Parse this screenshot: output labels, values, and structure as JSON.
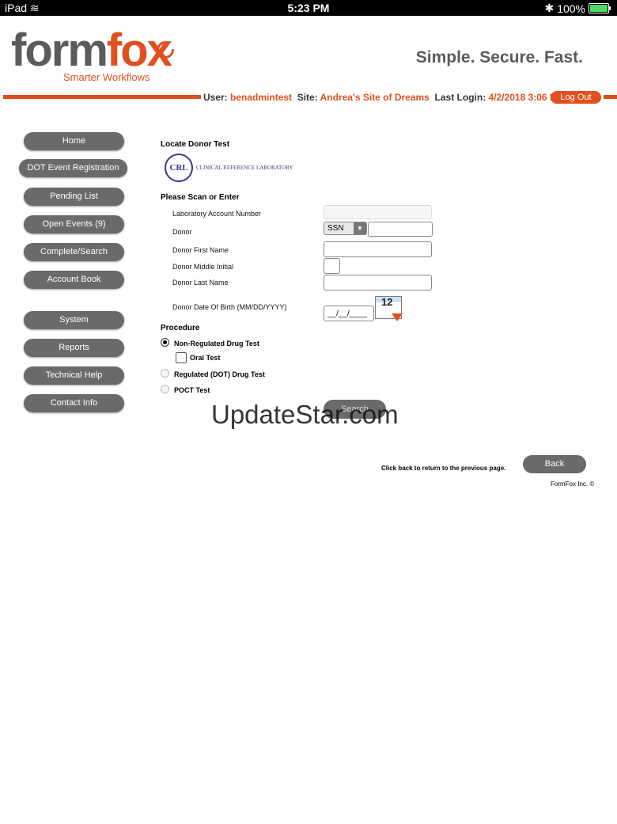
{
  "status_bar": {
    "device": "iPad",
    "time": "5:23 PM",
    "battery": "100%"
  },
  "brand": {
    "logo_form": "form",
    "logo_fox": "fox",
    "tagline": "Smarter Workflows",
    "slogan": "Simple. Secure. Fast.",
    "accent_color": "#e0501f"
  },
  "session": {
    "user_label": "User:",
    "user_value": "benadmintest",
    "site_label": "Site:",
    "site_value": "Andrea's Site of Dreams",
    "last_login_label": "Last Login:",
    "last_login_value": "4/2/2018 3:06 PM",
    "logout_label": "Log Out"
  },
  "nav": [
    {
      "label": "Home"
    },
    {
      "label": "DOT Event Registration"
    },
    {
      "label": "Pending List"
    },
    {
      "label": "Open Events (9)"
    },
    {
      "label": "Complete/Search"
    },
    {
      "label": "Account Book"
    },
    {
      "label": "System"
    },
    {
      "label": "Reports"
    },
    {
      "label": "Technical Help"
    },
    {
      "label": "Contact Info"
    }
  ],
  "form": {
    "title": "Locate Donor Test",
    "lab_logo_initials": "CRL",
    "lab_logo_name": "CLINICAL REFERENCE LABORATORY",
    "scan_heading": "Please Scan or Enter",
    "fields": {
      "lab_account": "Laboratory Account Number",
      "donor": "Donor",
      "first_name": "Donor First Name",
      "middle_initial": "Donor Middle Initial",
      "last_name": "Donor Last Name",
      "dob": "Donor Date Of Birth (MM/DD/YYYY)"
    },
    "donor_id_type": "SSN",
    "dob_value": "__/__/____",
    "calendar_day": "12",
    "procedure_heading": "Procedure",
    "procedures": {
      "non_regulated": "Non-Regulated Drug Test",
      "oral": "Oral Test",
      "regulated": "Regulated (DOT) Drug Test",
      "poct": "POCT Test"
    },
    "search_label": "Search"
  },
  "footer": {
    "back_hint": "Click back to return to the previous page.",
    "back_label": "Back",
    "copyright": "FormFox Inc. ©"
  },
  "watermark": "UpdateStar.com"
}
